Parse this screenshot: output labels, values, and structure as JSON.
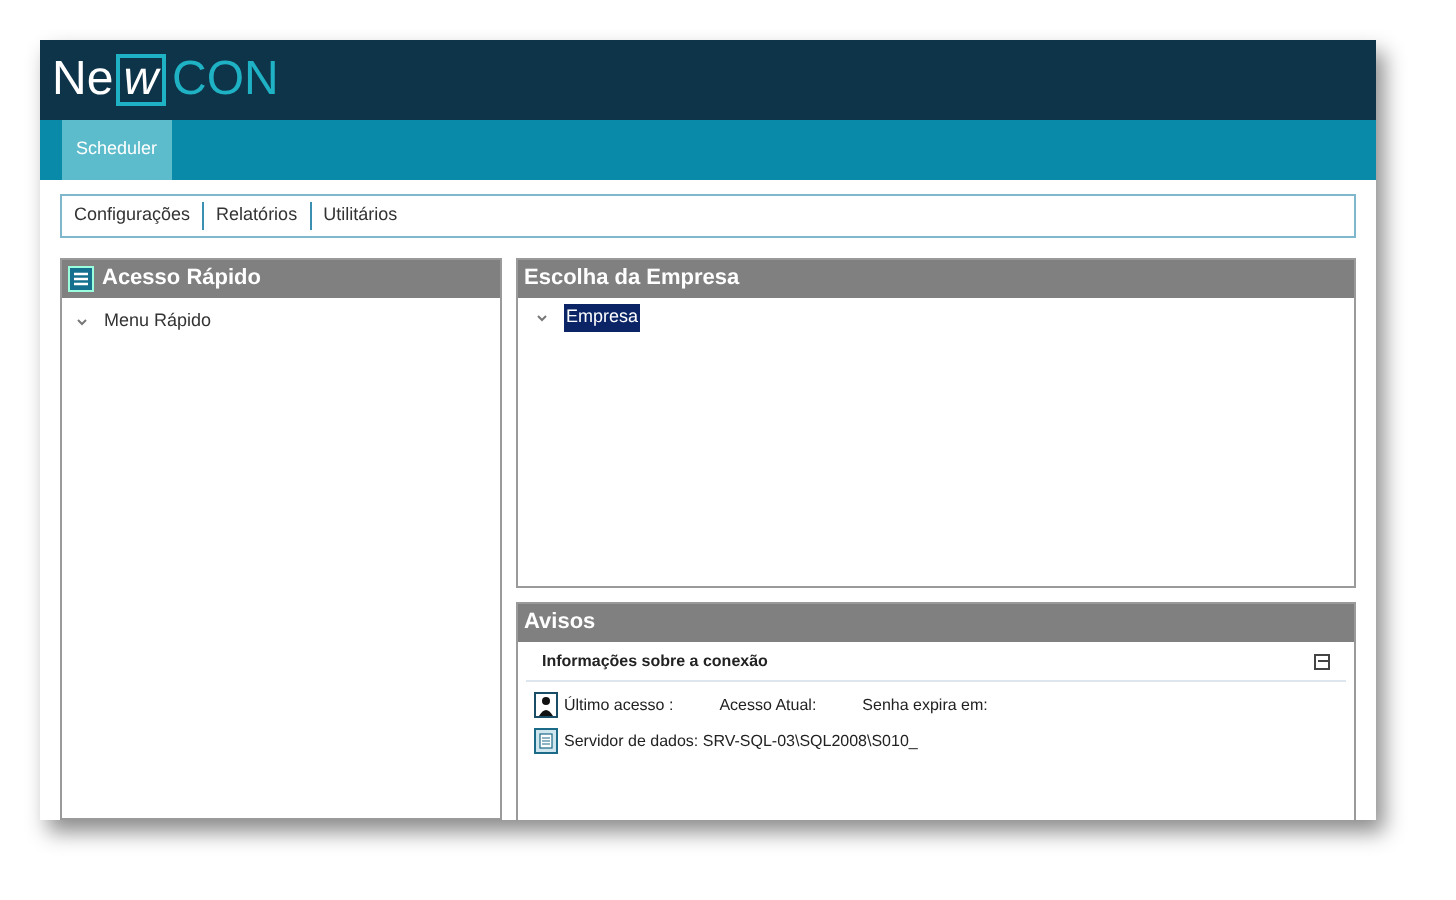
{
  "logo": {
    "left": "Ne",
    "boxed": "w",
    "right": "CON"
  },
  "tabs": [
    {
      "label": "Scheduler",
      "selected": true
    }
  ],
  "menu": [
    "Configurações",
    "Relatórios",
    "Utilitários"
  ],
  "quick_access": {
    "title": "Acesso Rápido",
    "items": [
      {
        "label": "Menu Rápido",
        "expanded": true
      }
    ]
  },
  "company": {
    "title": "Escolha da Empresa",
    "items": [
      {
        "label": "Empresa",
        "expanded": true,
        "selected": true
      }
    ]
  },
  "notices": {
    "title": "Avisos",
    "section": "Informações sobre a conexão",
    "expanded": true,
    "rows": [
      {
        "kind": "user",
        "texts": [
          "Último acesso :",
          "Acesso Atual:",
          "Senha expira em:"
        ]
      },
      {
        "kind": "server",
        "texts": [
          "Servidor de dados: SRV-SQL-03\\SQL2008\\S010_"
        ]
      }
    ]
  }
}
